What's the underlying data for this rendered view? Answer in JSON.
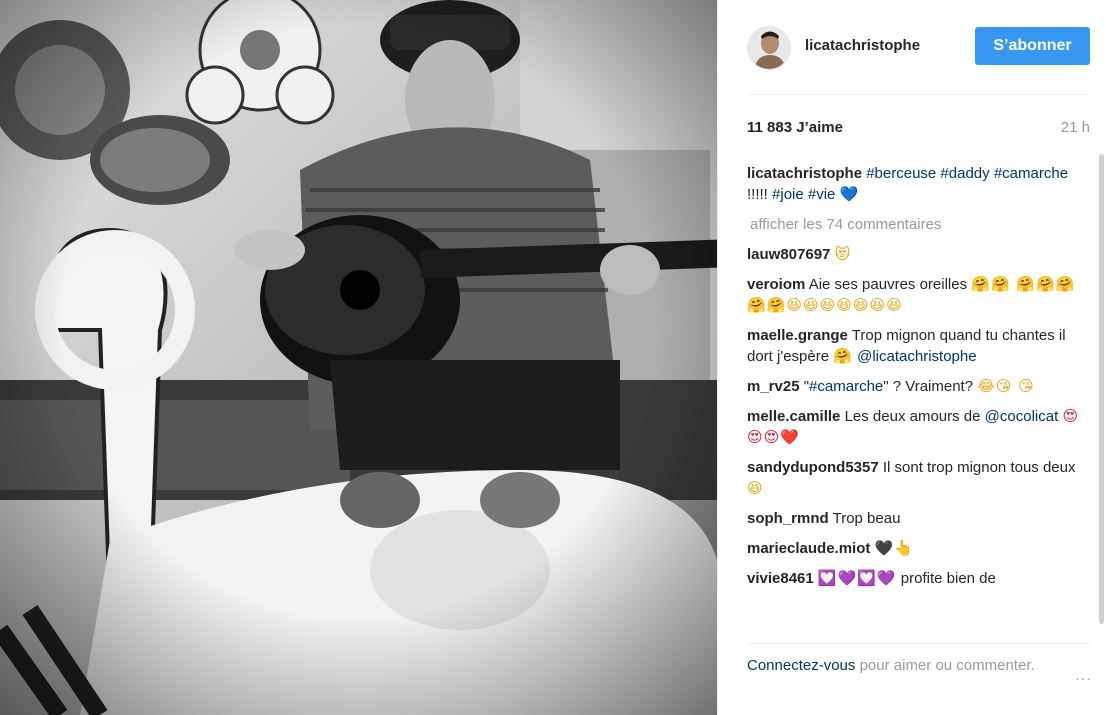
{
  "post": {
    "image_alt": "Black and white photo of a man playing an acoustic guitar next to a sleeping baby",
    "header": {
      "username": "licatachristophe",
      "follow_label": "S’abonner"
    },
    "likes_label": "11 883 J’aime",
    "time_label": "21 h",
    "caption": {
      "username": "licatachristophe",
      "hashtags_1": "#berceuse #daddy",
      "hashtag_2": "#camarche",
      "punct": " !!!!! ",
      "hashtags_3": "#joie #vie",
      "emoji": "💙"
    },
    "view_all_comments": "afficher les 74 commentaires",
    "comments": [
      {
        "user": "lauw807697",
        "text": "",
        "emoji": "😻"
      },
      {
        "user": "veroiom",
        "text": "Aie ses pauvres oreilles",
        "emoji": "🤗🤗 🤗🤗🤗🤗🤗😆😆😆😆😆😆😆"
      },
      {
        "user": "maelle.grange",
        "text": "Trop mignon quand tu chantes il dort j'espère",
        "emoji": "🤗",
        "mention": "@licatachristophe"
      },
      {
        "user": "m_rv25",
        "text_pre": "\"",
        "hashtag": "#camarche",
        "text": "\" ? Vraiment?",
        "emoji": "😂😘 😘"
      },
      {
        "user": "melle.camille",
        "text": "Les deux amours de",
        "mention": "@cocolicat",
        "emoji": "😍😍😍❤️"
      },
      {
        "user": "sandydupond5357",
        "text": "Il sont trop mignon tous deux",
        "emoji": "😆"
      },
      {
        "user": "soph_rmnd",
        "text": "Trop beau",
        "emoji": ""
      },
      {
        "user": "marieclaude.miot",
        "text": "",
        "emoji": "🖤👆"
      },
      {
        "user": "vivie8461",
        "text": "profite bien de",
        "emoji": "💟💜💟💜"
      }
    ],
    "footer": {
      "login_label": "Connectez-vous",
      "rest_label": " pour aimer ou commenter.",
      "more_icon": "···"
    }
  }
}
